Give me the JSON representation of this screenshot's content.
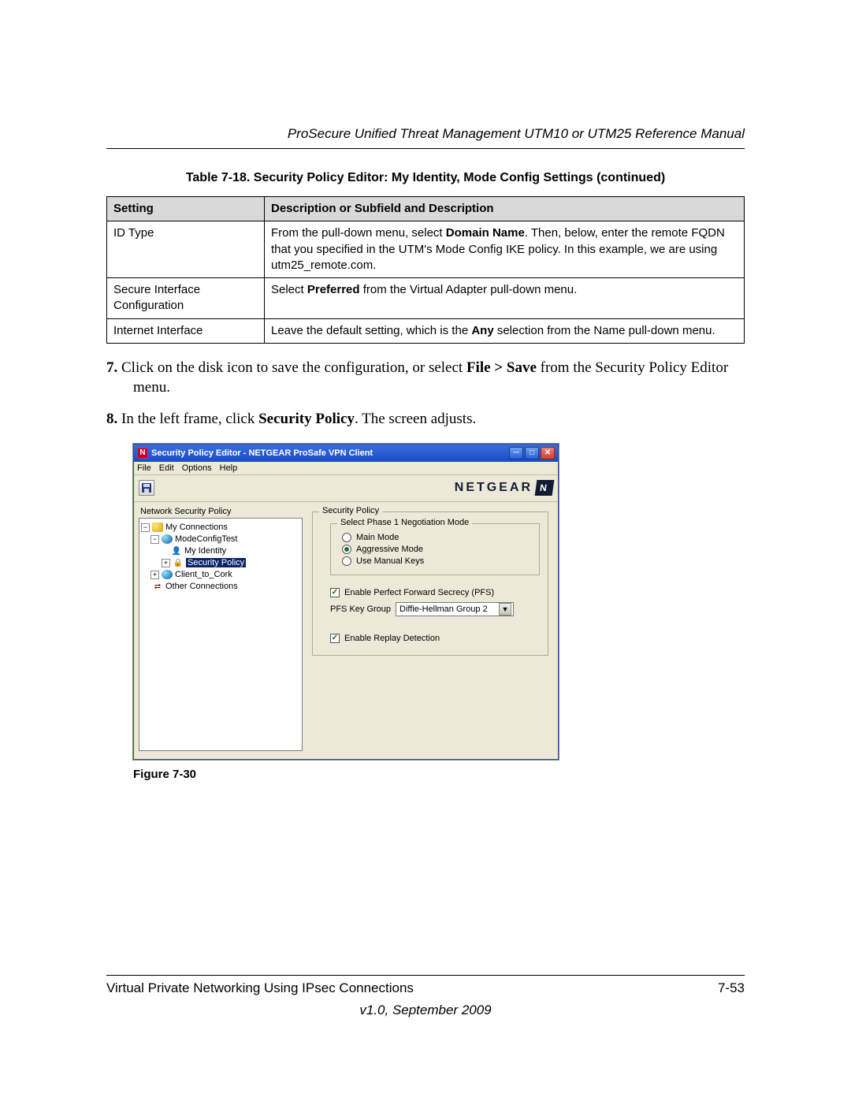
{
  "doc": {
    "header_title": "ProSecure Unified Threat Management UTM10 or UTM25 Reference Manual",
    "table_caption": "Table 7-18. Security Policy Editor: My Identity, Mode Config Settings (continued)",
    "th_setting": "Setting",
    "th_desc": "Description or Subfield and Description",
    "rows": [
      {
        "setting": "ID Type",
        "desc_pre": "From the pull-down menu, select ",
        "desc_b": "Domain Name",
        "desc_post": ". Then, below, enter the remote FQDN that you specified in the UTM's Mode Config IKE policy. In this example, we are using utm25_remote.com."
      },
      {
        "setting": "Secure Interface Configuration",
        "desc_pre": "Select ",
        "desc_b": "Preferred",
        "desc_post": " from the Virtual Adapter pull-down menu."
      },
      {
        "setting": "Internet Interface",
        "desc_pre": "Leave the default setting, which is the ",
        "desc_b": "Any",
        "desc_post": " selection from the Name pull-down menu."
      }
    ],
    "step7": {
      "num": "7.",
      "t1": "Click on the disk icon to save the configuration, or select ",
      "b1": "File > Save",
      "t2": " from the Security Policy Editor menu."
    },
    "step8": {
      "num": "8.",
      "t1": "In the left frame, click ",
      "b1": "Security Policy",
      "t2": ". The screen adjusts."
    },
    "figure_caption": "Figure 7-30",
    "footer_left": "Virtual Private Networking Using IPsec Connections",
    "footer_right": "7-53",
    "footer_version": "v1.0, September 2009"
  },
  "win": {
    "title": "Security Policy Editor - NETGEAR ProSafe VPN Client",
    "menu": {
      "file": "File",
      "edit": "Edit",
      "options": "Options",
      "help": "Help"
    },
    "brand": "NETGEAR",
    "tree_label": "Network Security Policy",
    "tree": {
      "my_connections": "My Connections",
      "mode_config_test": "ModeConfigTest",
      "my_identity": "My Identity",
      "security_policy": "Security Policy",
      "client_to_cork": "Client_to_Cork",
      "other_connections": "Other Connections"
    },
    "panel": {
      "group_title": "Security Policy",
      "phase1_title": "Select Phase 1 Negotiation Mode",
      "main_mode": "Main Mode",
      "aggressive_mode": "Aggressive Mode",
      "manual_keys": "Use Manual Keys",
      "enable_pfs": "Enable Perfect Forward Secrecy (PFS)",
      "pfs_label": "PFS Key Group",
      "pfs_value": "Diffie-Hellman Group 2",
      "enable_replay": "Enable Replay Detection"
    }
  }
}
